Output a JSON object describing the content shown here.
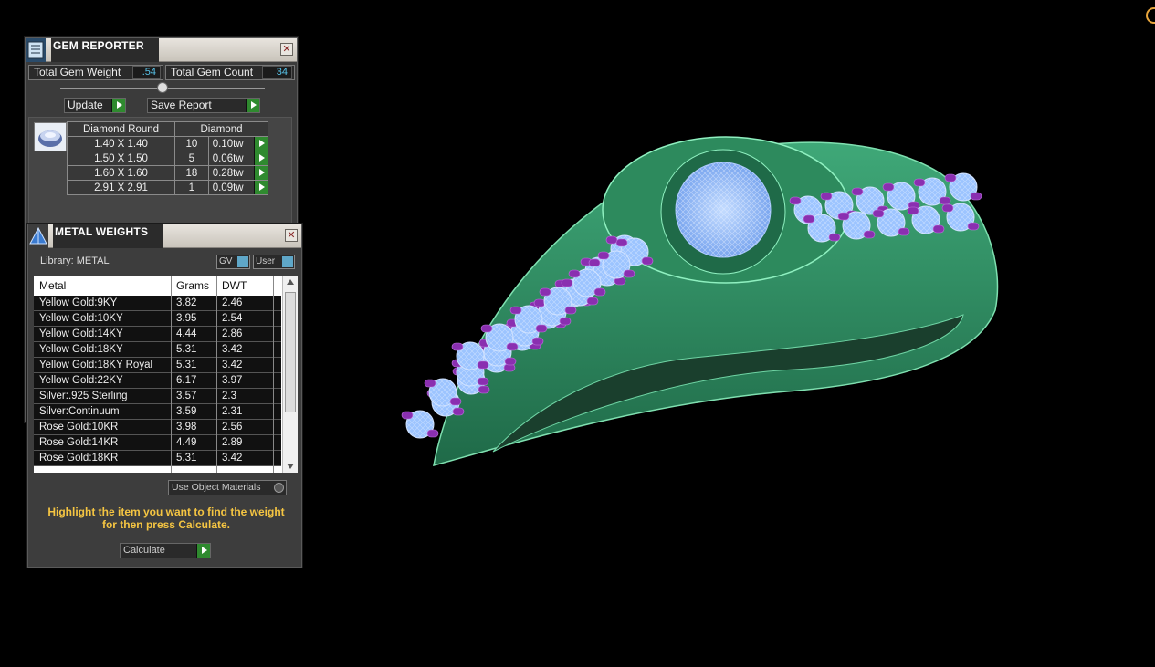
{
  "gem_reporter": {
    "title": "GEM REPORTER",
    "close": "✕",
    "total_weight_label": "Total Gem Weight",
    "total_weight_value": ".54",
    "total_count_label": "Total Gem Count",
    "total_count_value": "34",
    "update_label": "Update",
    "save_report_label": "Save Report",
    "table_headers": [
      "Diamond Round",
      "Diamond"
    ],
    "rows": [
      {
        "size": "1.40 X 1.40",
        "count": "10",
        "weight": "0.10tw"
      },
      {
        "size": "1.50 X 1.50",
        "count": "5",
        "weight": "0.06tw"
      },
      {
        "size": "1.60 X 1.60",
        "count": "18",
        "weight": "0.28tw"
      },
      {
        "size": "2.91 X 2.91",
        "count": "1",
        "weight": "0.09tw"
      }
    ]
  },
  "metal_weights": {
    "title": "METAL WEIGHTS",
    "close": "✕",
    "library_label": "Library: METAL",
    "gv_label": "GV",
    "user_label": "User",
    "columns": [
      "Metal",
      "Grams",
      "DWT"
    ],
    "rows": [
      {
        "metal": "Yellow Gold:9KY",
        "grams": "3.82",
        "dwt": "2.46"
      },
      {
        "metal": "Yellow Gold:10KY",
        "grams": "3.95",
        "dwt": "2.54"
      },
      {
        "metal": "Yellow Gold:14KY",
        "grams": "4.44",
        "dwt": "2.86"
      },
      {
        "metal": "Yellow Gold:18KY",
        "grams": "5.31",
        "dwt": "3.42"
      },
      {
        "metal": "Yellow Gold:18KY Royal",
        "grams": "5.31",
        "dwt": "3.42"
      },
      {
        "metal": "Yellow Gold:22KY",
        "grams": "6.17",
        "dwt": "3.97"
      },
      {
        "metal": "Silver:.925 Sterling",
        "grams": "3.57",
        "dwt": "2.3"
      },
      {
        "metal": "Silver:Continuum",
        "grams": "3.59",
        "dwt": "2.31"
      },
      {
        "metal": "Rose Gold:10KR",
        "grams": "3.98",
        "dwt": "2.56"
      },
      {
        "metal": "Rose Gold:14KR",
        "grams": "4.49",
        "dwt": "2.89"
      },
      {
        "metal": "Rose Gold:18KR",
        "grams": "5.31",
        "dwt": "3.42"
      }
    ],
    "use_object_materials_label": "Use Object Materials",
    "instruction": "Highlight the item you want to find the weight for then press Calculate.",
    "calculate_label": "Calculate"
  },
  "colors": {
    "ring_green": "#2e8a5e",
    "gem_blue": "#8fb8ff",
    "prong_purple": "#8a2fb0",
    "instruction_yellow": "#f5c542"
  }
}
